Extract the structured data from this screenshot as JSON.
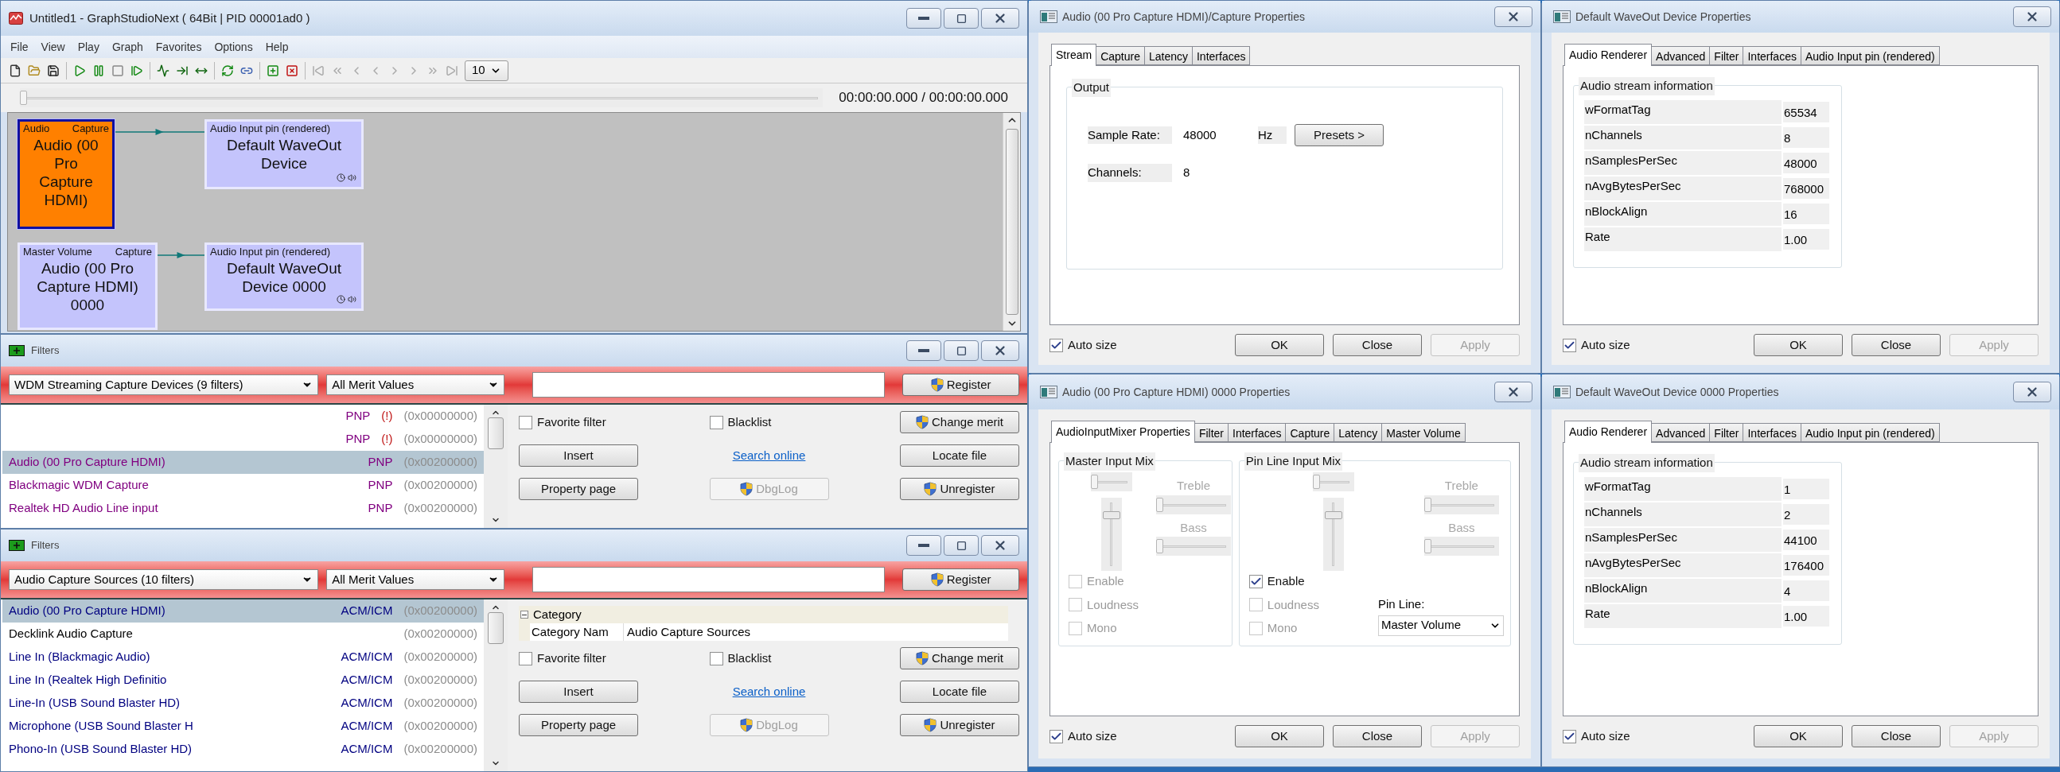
{
  "graph": {
    "title": "Untitled1 - GraphStudioNext ( 64Bit | PID 00001ad0 )",
    "menu": [
      "File",
      "View",
      "Play",
      "Graph",
      "Favorites",
      "Options",
      "Help"
    ],
    "rate_select": "10",
    "seek": {
      "level": 0
    },
    "time": "00:00:00.000 / 00:00:00.000",
    "nodes": [
      {
        "name": "Audio (00 Pro Capture HDMI)",
        "input_pin": "Audio",
        "output_pin": "Capture",
        "selected": true,
        "kind": "source"
      },
      {
        "name": "Default WaveOut Device",
        "input_pin": "Audio Input pin (rendered)",
        "selected": false,
        "kind": "renderer"
      },
      {
        "name": "Audio (00 Pro Capture HDMI) 0000",
        "input_pin": "Master Volume",
        "output_pin": "Capture",
        "selected": false,
        "kind": "source"
      },
      {
        "name": "Default WaveOut Device 0000",
        "input_pin": "Audio Input pin (rendered)",
        "selected": false,
        "kind": "renderer"
      }
    ]
  },
  "filter_windows": [
    {
      "title": "Filters",
      "category": "WDM Streaming Capture Devices (9 filters)",
      "merit": "All Merit Values",
      "register": "Register",
      "rows": [
        {
          "type": "PNP",
          "warning": "(!)",
          "merit": "(0x00000000)",
          "selected": false,
          "color": "#800080"
        },
        {
          "type": "PNP",
          "warning": "(!)",
          "merit": "(0x00000000)",
          "selected": false,
          "color": "#800080"
        },
        {
          "name": "Audio (00 Pro Capture HDMI)",
          "type": "PNP",
          "merit": "(0x00200000)",
          "selected": true,
          "color": "#800080"
        },
        {
          "name": "Blackmagic WDM Capture",
          "type": "PNP",
          "merit": "(0x00200000)",
          "selected": false,
          "color": "#800080"
        },
        {
          "name": "Realtek HD Audio Line input",
          "type": "PNP",
          "merit": "(0x00200000)",
          "selected": false,
          "color": "#800080"
        }
      ],
      "controls": [
        {
          "kind": "checkbox",
          "label": "Favorite filter",
          "checked": false
        },
        {
          "kind": "checkbox",
          "label": "Blacklist",
          "checked": false
        },
        {
          "kind": "shield_button",
          "label": "Change merit",
          "disabled": false
        },
        {
          "kind": "button",
          "label": "Insert",
          "disabled": false
        },
        {
          "kind": "link",
          "label": "Search online"
        },
        {
          "kind": "button",
          "label": "Locate file",
          "disabled": false
        },
        {
          "kind": "button",
          "label": "Property page",
          "disabled": false
        },
        {
          "kind": "shield_button",
          "label": "DbgLog",
          "disabled": true
        },
        {
          "kind": "shield_button",
          "label": "Unregister",
          "disabled": false
        }
      ]
    },
    {
      "title": "Filters",
      "category": "Audio Capture Sources (10 filters)",
      "merit": "All Merit Values",
      "register": "Register",
      "rows": [
        {
          "name": "Audio (00 Pro Capture HDMI)",
          "type": "ACM/ICM",
          "merit": "(0x00200000)",
          "selected": true,
          "color": "#000080"
        },
        {
          "name": "Decklink Audio Capture",
          "merit": "(0x00200000)",
          "selected": false,
          "color": "#000000"
        },
        {
          "name": "Line In (Blackmagic Audio)",
          "type": "ACM/ICM",
          "merit": "(0x00200000)",
          "selected": false,
          "color": "#000080"
        },
        {
          "name": "Line In (Realtek High Definitio",
          "type": "ACM/ICM",
          "merit": "(0x00200000)",
          "selected": false,
          "color": "#000080"
        },
        {
          "name": "Line-In (USB Sound Blaster HD)",
          "type": "ACM/ICM",
          "merit": "(0x00200000)",
          "selected": false,
          "color": "#000080"
        },
        {
          "name": "Microphone (USB Sound Blaster H",
          "type": "ACM/ICM",
          "merit": "(0x00200000)",
          "selected": false,
          "color": "#000080"
        },
        {
          "name": "Phono-In (USB Sound Blaster HD)",
          "type": "ACM/ICM",
          "merit": "(0x00200000)",
          "selected": false,
          "color": "#000080"
        }
      ],
      "properties": {
        "heading": "Category",
        "expanded": true,
        "rows": [
          {
            "key": "Category Nam",
            "value": "Audio Capture Sources"
          }
        ]
      },
      "controls": [
        {
          "kind": "checkbox",
          "label": "Favorite filter",
          "checked": false
        },
        {
          "kind": "checkbox",
          "label": "Blacklist",
          "checked": false
        },
        {
          "kind": "shield_button",
          "label": "Change merit",
          "disabled": false
        },
        {
          "kind": "button",
          "label": "Insert",
          "disabled": false
        },
        {
          "kind": "link",
          "label": "Search online"
        },
        {
          "kind": "button",
          "label": "Locate file",
          "disabled": false
        },
        {
          "kind": "button",
          "label": "Property page",
          "disabled": false
        },
        {
          "kind": "shield_button",
          "label": "DbgLog",
          "disabled": true
        },
        {
          "kind": "shield_button",
          "label": "Unregister",
          "disabled": false
        }
      ]
    }
  ],
  "dialogs": [
    {
      "title": "Audio (00 Pro Capture HDMI)/Capture Properties",
      "tabs": [
        {
          "label": "Stream",
          "selected": true
        },
        {
          "label": "Capture",
          "selected": false
        },
        {
          "label": "Latency",
          "selected": false
        },
        {
          "label": "Interfaces",
          "selected": false
        }
      ],
      "content": {
        "kind": "stream",
        "group": "Output",
        "fields": [
          {
            "label": "Sample Rate:",
            "value": "48000",
            "unit": "Hz",
            "button": "Presets >"
          },
          {
            "label": "Channels:",
            "value": "8"
          }
        ]
      },
      "auto_size": {
        "label": "Auto size",
        "checked": true
      },
      "buttons": [
        {
          "label": "OK",
          "disabled": false
        },
        {
          "label": "Close",
          "disabled": false
        },
        {
          "label": "Apply",
          "disabled": true
        }
      ]
    },
    {
      "title": "Default WaveOut Device Properties",
      "tabs": [
        {
          "label": "Audio Renderer",
          "selected": true
        },
        {
          "label": "Advanced",
          "selected": false
        },
        {
          "label": "Filter",
          "selected": false
        },
        {
          "label": "Interfaces",
          "selected": false
        },
        {
          "label": "Audio Input pin (rendered)",
          "selected": false
        }
      ],
      "content": {
        "kind": "info",
        "group": "Audio stream information",
        "rows": [
          {
            "key": "wFormatTag",
            "value": "65534"
          },
          {
            "key": "nChannels",
            "value": "8"
          },
          {
            "key": "nSamplesPerSec",
            "value": "48000"
          },
          {
            "key": "nAvgBytesPerSec",
            "value": "768000"
          },
          {
            "key": "nBlockAlign",
            "value": "16"
          },
          {
            "key": "Rate",
            "value": "1.00"
          }
        ]
      },
      "auto_size": {
        "label": "Auto size",
        "checked": true
      },
      "buttons": [
        {
          "label": "OK",
          "disabled": false
        },
        {
          "label": "Close",
          "disabled": false
        },
        {
          "label": "Apply",
          "disabled": true
        }
      ]
    },
    {
      "title": "Audio (00 Pro Capture HDMI) 0000 Properties",
      "tabs": [
        {
          "label": "AudioInputMixer Properties",
          "selected": true
        },
        {
          "label": "Filter",
          "selected": false
        },
        {
          "label": "Interfaces",
          "selected": false
        },
        {
          "label": "Capture",
          "selected": false
        },
        {
          "label": "Latency",
          "selected": false
        },
        {
          "label": "Master Volume",
          "selected": false
        }
      ],
      "content": {
        "kind": "mixer",
        "groups": [
          {
            "title": "Master Input Mix",
            "disabled": true,
            "balance": {
              "level": 0
            },
            "volume": {
              "level": 0.8
            },
            "treble_label": "Treble",
            "treble": {
              "level": 0
            },
            "bass_label": "Bass",
            "bass": {
              "level": 0
            },
            "checks": [
              {
                "label": "Enable",
                "checked": false,
                "disabled": true
              },
              {
                "label": "Loudness",
                "checked": false,
                "disabled": true
              },
              {
                "label": "Mono",
                "checked": false,
                "disabled": true
              }
            ]
          },
          {
            "title": "Pin Line Input Mix",
            "disabled": true,
            "balance": {
              "level": 0
            },
            "volume": {
              "level": 0.8
            },
            "treble_label": "Treble",
            "treble": {
              "level": 0
            },
            "bass_label": "Bass",
            "bass": {
              "level": 0
            },
            "checks": [
              {
                "label": "Enable",
                "checked": true,
                "disabled": false
              },
              {
                "label": "Loudness",
                "checked": false,
                "disabled": true
              },
              {
                "label": "Mono",
                "checked": false,
                "disabled": true
              }
            ],
            "pin_line": {
              "label": "Pin Line:",
              "value": "Master Volume"
            }
          }
        ]
      },
      "auto_size": {
        "label": "Auto size",
        "checked": true
      },
      "buttons": [
        {
          "label": "OK",
          "disabled": false
        },
        {
          "label": "Close",
          "disabled": false
        },
        {
          "label": "Apply",
          "disabled": true
        }
      ]
    },
    {
      "title": "Default WaveOut Device 0000 Properties",
      "tabs": [
        {
          "label": "Audio Renderer",
          "selected": true
        },
        {
          "label": "Advanced",
          "selected": false
        },
        {
          "label": "Filter",
          "selected": false
        },
        {
          "label": "Interfaces",
          "selected": false
        },
        {
          "label": "Audio Input pin (rendered)",
          "selected": false
        }
      ],
      "content": {
        "kind": "info",
        "group": "Audio stream information",
        "rows": [
          {
            "key": "wFormatTag",
            "value": "1"
          },
          {
            "key": "nChannels",
            "value": "2"
          },
          {
            "key": "nSamplesPerSec",
            "value": "44100"
          },
          {
            "key": "nAvgBytesPerSec",
            "value": "176400"
          },
          {
            "key": "nBlockAlign",
            "value": "4"
          },
          {
            "key": "Rate",
            "value": "1.00"
          }
        ]
      },
      "auto_size": {
        "label": "Auto size",
        "checked": true
      },
      "buttons": [
        {
          "label": "OK",
          "disabled": false
        },
        {
          "label": "Close",
          "disabled": false
        },
        {
          "label": "Apply",
          "disabled": true
        }
      ]
    }
  ]
}
